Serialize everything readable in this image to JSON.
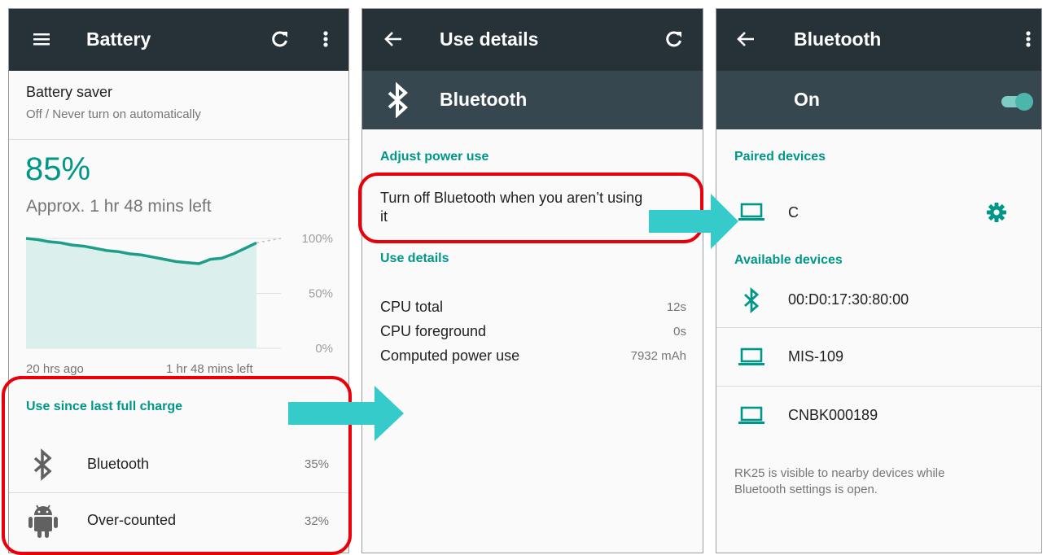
{
  "colors": {
    "accent": "#009688",
    "appbar": "#263238",
    "subbar": "#37474f",
    "highlight": "#e8000b",
    "arrow": "#35cbcb"
  },
  "battery": {
    "title": "Battery",
    "saver_title": "Battery saver",
    "saver_subtitle": "Off / Never turn on automatically",
    "percent": "85%",
    "time_left": "Approx. 1 hr 48 mins left",
    "chart_y_labels": [
      "100%",
      "50%",
      "0%"
    ],
    "chart_x_start": "20 hrs ago",
    "chart_x_end": "1 hr 48 mins left",
    "use_header": "Use since last full charge",
    "items": [
      {
        "label": "Bluetooth",
        "value": "35%",
        "icon": "bluetooth-icon"
      },
      {
        "label": "Over-counted",
        "value": "32%",
        "icon": "android-icon"
      }
    ]
  },
  "details": {
    "title": "Use details",
    "app_name": "Bluetooth",
    "adjust_header": "Adjust power use",
    "adjust_line1": "Turn off Bluetooth when you aren’t using",
    "adjust_line2": "it",
    "use_header": "Use details",
    "rows": [
      {
        "label": "CPU total",
        "value": "12s"
      },
      {
        "label": "CPU foreground",
        "value": "0s"
      },
      {
        "label": "Computed power use",
        "value": "7932 mAh"
      }
    ]
  },
  "bluetooth": {
    "title": "Bluetooth",
    "toggle_label": "On",
    "paired_header": "Paired devices",
    "paired": [
      {
        "name": "C",
        "icon": "laptop-icon"
      }
    ],
    "available_header": "Available devices",
    "available": [
      {
        "name": "00:D0:17:30:80:00",
        "icon": "bluetooth-icon"
      },
      {
        "name": "MIS-109",
        "icon": "laptop-icon"
      },
      {
        "name": "CNBK000189",
        "icon": "laptop-icon"
      }
    ],
    "footer_line1": "RK25 is visible to nearby devices while",
    "footer_line2": "Bluetooth settings is open."
  },
  "chart_data": {
    "type": "area",
    "title": "",
    "xlabel": "",
    "ylabel": "",
    "x_labels": [
      "20 hrs ago",
      "1 hr 48 mins left"
    ],
    "y_ticks": [
      "100%",
      "50%",
      "0%"
    ],
    "ylim": [
      0,
      100
    ],
    "series": [
      {
        "x": [
          0,
          1,
          2,
          3,
          4,
          5,
          6,
          7,
          8,
          9,
          10,
          11,
          12,
          13,
          14,
          15,
          16,
          17,
          18,
          19,
          20
        ],
        "values": [
          100,
          99,
          97,
          96,
          94,
          93,
          91,
          89,
          88,
          86,
          85,
          83,
          81,
          79,
          78,
          77,
          81,
          82,
          86,
          91,
          96
        ]
      }
    ],
    "projection": [
      96,
      100
    ],
    "grid": true
  }
}
